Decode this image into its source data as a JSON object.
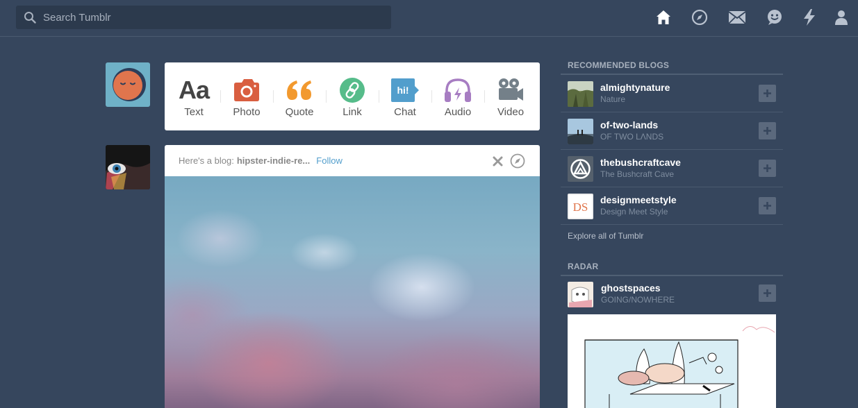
{
  "header": {
    "search_placeholder": "Search Tumblr",
    "nav_icons": [
      "home-icon",
      "explore-icon",
      "inbox-icon",
      "messaging-icon",
      "activity-icon",
      "account-icon"
    ]
  },
  "post_types": [
    {
      "label": "Text",
      "icon": "text-icon",
      "color": "#444444"
    },
    {
      "label": "Photo",
      "icon": "camera-icon",
      "color": "#d95e40"
    },
    {
      "label": "Quote",
      "icon": "quote-icon",
      "color": "#f2992e"
    },
    {
      "label": "Link",
      "icon": "link-icon",
      "color": "#56bc8a"
    },
    {
      "label": "Chat",
      "icon": "chat-icon",
      "color": "#529ecc"
    },
    {
      "label": "Audio",
      "icon": "headphones-icon",
      "color": "#a77dc2"
    },
    {
      "label": "Video",
      "icon": "video-camera-icon",
      "color": "#748089"
    }
  ],
  "recommended_post": {
    "intro": "Here's a blog:",
    "blog_name": "hipster-indie-re...",
    "follow_label": "Follow"
  },
  "sidebar": {
    "recommended_title": "RECOMMENDED BLOGS",
    "blogs": [
      {
        "name": "almightynature",
        "title": "Nature"
      },
      {
        "name": "of-two-lands",
        "title": "OF TWO LΛNDS"
      },
      {
        "name": "thebushcraftcave",
        "title": "The Bushcraft Cave"
      },
      {
        "name": "designmeetstyle",
        "title": "Design Meet Style",
        "thumb_text": "DS"
      }
    ],
    "explore_label": "Explore all of Tumblr",
    "radar_title": "RADAR",
    "radar": {
      "name": "ghostspaces",
      "title": "GOING/NOWHERE"
    }
  },
  "colors": {
    "background": "#36465d",
    "link_blue": "#529ecc"
  }
}
